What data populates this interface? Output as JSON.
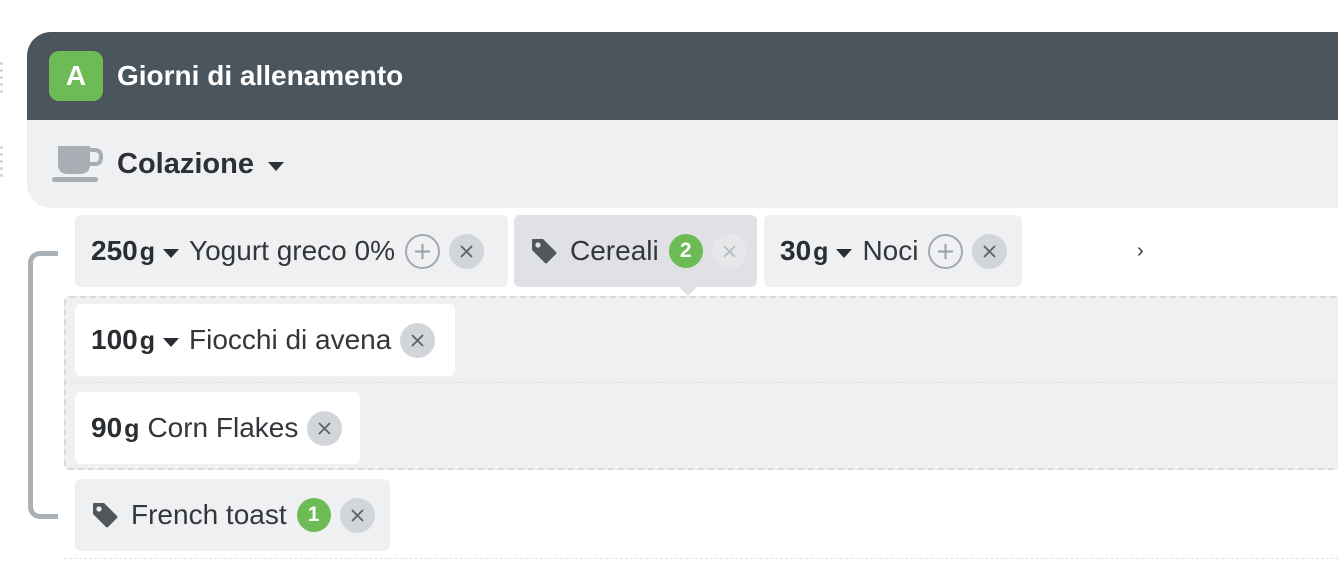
{
  "plan": {
    "badge": "A",
    "title": "Giorni di allenamento"
  },
  "meal": {
    "icon": "coffee-cup-icon",
    "title": "Colazione"
  },
  "row1": [
    {
      "qty": "250",
      "unit": "g",
      "name": "Yogurt greco 0%"
    },
    {
      "tag": "Cereali",
      "count": "2"
    },
    {
      "qty": "30",
      "unit": "g",
      "name": "Noci"
    }
  ],
  "group": [
    {
      "qty": "100",
      "unit": "g",
      "name": "Fiocchi di avena"
    },
    {
      "qty": "90",
      "unit": "g",
      "name": "Corn Flakes"
    }
  ],
  "row_bottom": {
    "tag": "French toast",
    "count": "1"
  },
  "scroll_glyph": "›",
  "colors": {
    "header_bg": "#4a555e",
    "accent_green": "#6dbb54",
    "chip_bg": "#eff0f2"
  }
}
